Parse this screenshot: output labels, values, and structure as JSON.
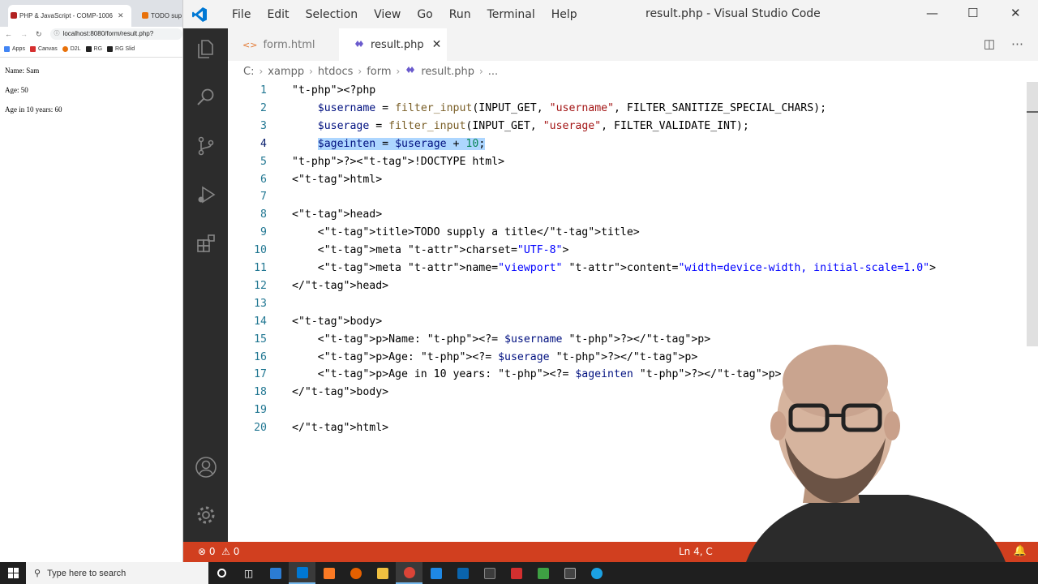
{
  "browser": {
    "tabs": [
      {
        "label": "PHP & JavaScript - COMP-1006",
        "close": "✕"
      },
      {
        "label": "TODO sup"
      }
    ],
    "address": "localhost:8080/form/result.php?",
    "bookmarks": [
      "Apps",
      "Canvas",
      "D2L",
      "RG",
      "RG Slid"
    ],
    "page_lines": [
      "Name: Sam",
      "Age: 50",
      "Age in 10 years: 60"
    ]
  },
  "vscode": {
    "menu": [
      "File",
      "Edit",
      "Selection",
      "View",
      "Go",
      "Run",
      "Terminal",
      "Help"
    ],
    "window_title": "result.php - Visual Studio Code",
    "tabs": [
      {
        "label": "form.html",
        "icon": "<>"
      },
      {
        "label": "result.php",
        "icon": "php-icon",
        "close": "✕"
      }
    ],
    "breadcrumb": [
      "C:",
      "xampp",
      "htdocs",
      "form",
      "result.php",
      "..."
    ],
    "status": {
      "errors": "0",
      "warnings": "0",
      "position": "Ln 4, C"
    },
    "code_lines": [
      "<?php",
      "    $username = filter_input(INPUT_GET, \"username\", FILTER_SANITIZE_SPECIAL_CHARS);",
      "    $userage = filter_input(INPUT_GET, \"userage\", FILTER_VALIDATE_INT);",
      "    $ageinten = $userage + 10;",
      "?><!DOCTYPE html>",
      "<html>",
      "",
      "<head>",
      "    <title>TODO supply a title</title>",
      "    <meta charset=\"UTF-8\">",
      "    <meta name=\"viewport\" content=\"width=device-width, initial-scale=1.0\">",
      "</head>",
      "",
      "<body>",
      "    <p>Name: <?= $username ?></p>",
      "    <p>Age: <?= $userage ?></p>",
      "    <p>Age in 10 years: <?= $ageinten ?></p>",
      "</body>",
      "",
      "</html>"
    ]
  },
  "taskbar": {
    "search_placeholder": "Type here to search"
  },
  "colors": {
    "status_bar": "#d13f1f",
    "activity_bar": "#2c2c2c",
    "selection": "#add6ff"
  }
}
